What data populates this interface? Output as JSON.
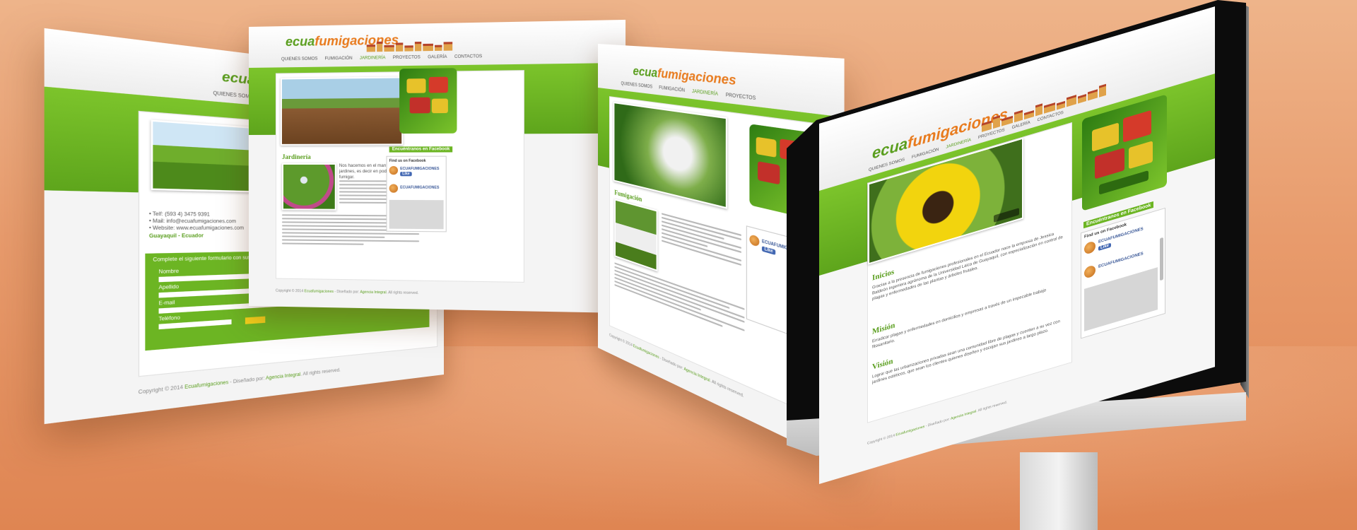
{
  "brand": {
    "logo_main": "ecua",
    "logo_accent": "fumigaciones",
    "green": "#6cb523",
    "orange": "#e87b1e"
  },
  "nav": [
    "QUIENES SOMOS",
    "FUMIGACIÓN",
    "JARDINERÍA",
    "PROYECTOS",
    "GALERÍA",
    "CONTACTOS"
  ],
  "nav_active": "JARDINERÍA",
  "page_jardineria": {
    "section_title": "Jardinería",
    "intro": "Nos hacemos en el mantenimiento de jardines, es decir en podar, limpiar y fumigar.",
    "facebook_header": "Encuéntranos en Facebook",
    "facebook_find": "Find us on Facebook",
    "facebook_name": "ECUAFUMIGACIONES",
    "like": "Like"
  },
  "page_contactos": {
    "phone": "• Telf: (593 4) 3475 9391",
    "mail": "• Mail: info@ecuafumigaciones.com",
    "web": "• Website: www.ecuafumigaciones.com",
    "city": "Guayaquil - Ecuador",
    "form_intro": "Complete el siguiente formulario con sus datos",
    "fields": [
      "Nombre",
      "Apellido",
      "E-mail",
      "Teléfono"
    ]
  },
  "page_fumigacion": {
    "section_title": "Fumigación"
  },
  "imac_page": {
    "facebook_header": "Encuéntranos en Facebook",
    "facebook_find": "Find us on Facebook",
    "facebook_name": "ECUAFUMIGACIONES",
    "like": "Like",
    "sections": [
      {
        "title": "Inicios",
        "text": "Gracias a la presencia de fumigaciones profesionales en el Ecuador nace la empresa de Jessica Baldeón ingeniera agrónoma de la Universidad Laica de Guayaquil, con especialización en control de plagas y enfermedades de las plantas y árboles frutales."
      },
      {
        "title": "Misión",
        "text": "Erradicar plagas y enfermedades en domicilios y empresas a través de un impecable trabajo fitosanitario."
      },
      {
        "title": "Visión",
        "text": "Lograr que las urbanizaciones privadas sean una comunidad libre de plagas y cuenten a su vez con jardines estéticos, que sean los clientes quienes diseñen y escojan sus jardines a largo plazo."
      }
    ]
  },
  "footer": {
    "copyright": "Copyright © 2014",
    "company": "Ecuafumigaciones",
    "design_by": " - Diseñado por:",
    "agency": "Agencia Integral",
    "rights": ". All rights reserved."
  }
}
